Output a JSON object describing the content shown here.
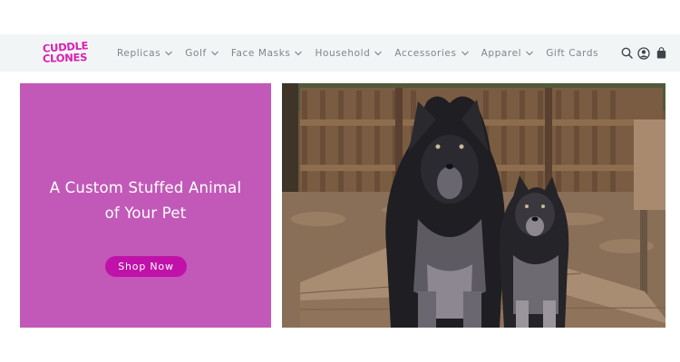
{
  "logo": {
    "line1": "CUDDLE",
    "line2": "CLONES"
  },
  "nav": {
    "items": [
      {
        "label": "Replicas"
      },
      {
        "label": "Golf"
      },
      {
        "label": "Face Masks"
      },
      {
        "label": "Household"
      },
      {
        "label": "Accessories"
      },
      {
        "label": "Apparel"
      }
    ],
    "gift_cards": "Gift Cards"
  },
  "header_icons": [
    "search-icon",
    "account-icon",
    "cart-icon"
  ],
  "promo": {
    "title_line1": "A Custom Stuffed Animal",
    "title_line2": "of Your Pet",
    "button": "Shop Now"
  },
  "colors": {
    "header_bg": "#f2f5f6",
    "promo_bg": "#c259b8",
    "button_bg": "#c012a8",
    "logo": "#d62bb5",
    "nav_text": "#7e858c"
  }
}
